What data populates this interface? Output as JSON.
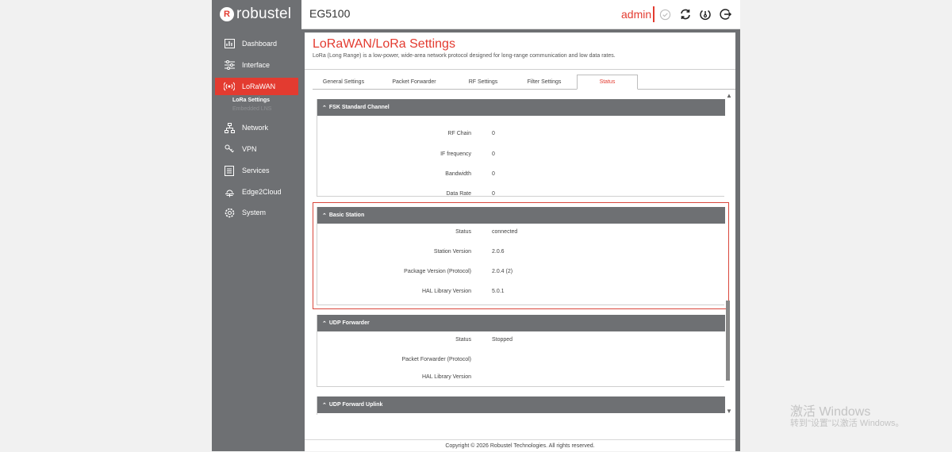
{
  "brand": {
    "logo_text": "robustel",
    "logo_mark": "R"
  },
  "header": {
    "model": "EG5100",
    "user": "admin"
  },
  "colors": {
    "accent": "#e33b30",
    "sidebar": "#6e7073"
  },
  "toolbar_icons": [
    "check-circle-icon",
    "refresh-icon",
    "reboot-icon",
    "logout-icon"
  ],
  "sidebar": {
    "items": [
      {
        "label": "Dashboard",
        "icon": "dashboard-icon",
        "active": false
      },
      {
        "label": "Interface",
        "icon": "sliders-icon",
        "active": false
      },
      {
        "label": "LoRaWAN",
        "icon": "antenna-icon",
        "active": true
      },
      {
        "label": "Network",
        "icon": "network-icon",
        "active": false
      },
      {
        "label": "VPN",
        "icon": "vpn-icon",
        "active": false
      },
      {
        "label": "Services",
        "icon": "services-icon",
        "active": false
      },
      {
        "label": "Edge2Cloud",
        "icon": "cloud-icon",
        "active": false
      },
      {
        "label": "System",
        "icon": "gear-icon",
        "active": false
      }
    ],
    "sub_items": [
      {
        "label": "LoRa Settings",
        "active": true
      },
      {
        "label": "Embedded LNS",
        "active": false
      }
    ]
  },
  "page": {
    "title": "LoRaWAN/LoRa Settings",
    "description": "LoRa (Long Range) is a low-power, wide-area network protocol designed for long-range communication and low data rates."
  },
  "tabs": [
    {
      "label": "General Settings",
      "active": false
    },
    {
      "label": "Packet Forwarder",
      "active": false
    },
    {
      "label": "RF Settings",
      "active": false
    },
    {
      "label": "Filter Settings",
      "active": false
    },
    {
      "label": "Status",
      "active": true
    }
  ],
  "sections": {
    "fsk": {
      "title": "FSK Standard Channel",
      "rows": [
        {
          "label": "RF Chain",
          "value": "0"
        },
        {
          "label": "IF frequency",
          "value": "0"
        },
        {
          "label": "Bandwidth",
          "value": "0"
        },
        {
          "label": "Data Rate",
          "value": "0"
        }
      ]
    },
    "basic_station": {
      "title": "Basic Station",
      "rows": [
        {
          "label": "Status",
          "value": "connected"
        },
        {
          "label": "Station Version",
          "value": "2.0.6"
        },
        {
          "label": "Package Version (Protocol)",
          "value": "2.0.4 (2)"
        },
        {
          "label": "HAL Library Version",
          "value": "5.0.1"
        }
      ]
    },
    "udp_forwarder": {
      "title": "UDP Forwarder",
      "rows": [
        {
          "label": "Status",
          "value": "Stopped"
        },
        {
          "label": "Packet Forwarder (Protocol)",
          "value": ""
        },
        {
          "label": "HAL Library Version",
          "value": ""
        }
      ]
    },
    "udp_uplink": {
      "title": "UDP Forward Uplink"
    }
  },
  "footer": "Copyright © 2026 Robustel Technologies. All rights reserved.",
  "os_watermark": {
    "line1": "激活 Windows",
    "line2": "转到\"设置\"以激活 Windows。"
  }
}
